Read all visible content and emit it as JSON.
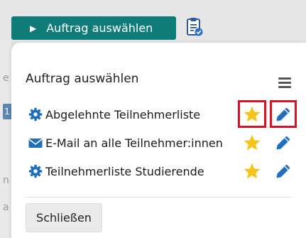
{
  "toolbar": {
    "order_button_label": "Auftrag auswählen",
    "caret_icon": "triangle-right",
    "clipboard_icon": "clipboard-check-icon"
  },
  "background": {
    "left_letters": [
      "e",
      "n",
      "a"
    ],
    "left_badge": "1"
  },
  "popup": {
    "title": "Auftrag auswählen",
    "menu_icon": "hamburger-icon",
    "items": [
      {
        "label": "Abgelehnte Teilnehmerliste",
        "icon": "gear-icon",
        "highlighted": true
      },
      {
        "label": "E-Mail an alle Teilnehmer:innen",
        "icon": "envelope-icon",
        "highlighted": false
      },
      {
        "label": "Teilnehmerliste Studierende",
        "icon": "gear-icon",
        "highlighted": false
      }
    ],
    "close_label": "Schließen"
  },
  "colors": {
    "button_teal": "#0f7c7a",
    "icon_blue": "#1f6fc0",
    "star_yellow": "#f6c31a",
    "highlight_red": "#e01020"
  }
}
